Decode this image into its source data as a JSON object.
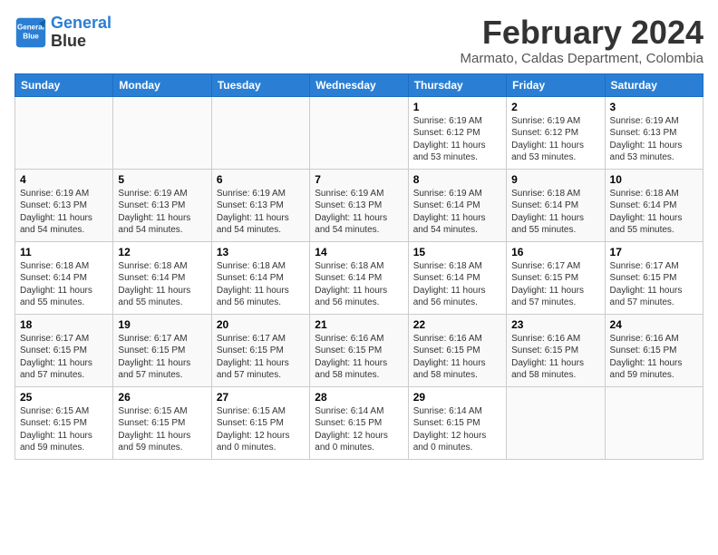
{
  "header": {
    "logo_line1": "General",
    "logo_line2": "Blue",
    "title": "February 2024",
    "subtitle": "Marmato, Caldas Department, Colombia"
  },
  "weekdays": [
    "Sunday",
    "Monday",
    "Tuesday",
    "Wednesday",
    "Thursday",
    "Friday",
    "Saturday"
  ],
  "weeks": [
    [
      {
        "day": "",
        "info": ""
      },
      {
        "day": "",
        "info": ""
      },
      {
        "day": "",
        "info": ""
      },
      {
        "day": "",
        "info": ""
      },
      {
        "day": "1",
        "info": "Sunrise: 6:19 AM\nSunset: 6:12 PM\nDaylight: 11 hours\nand 53 minutes."
      },
      {
        "day": "2",
        "info": "Sunrise: 6:19 AM\nSunset: 6:12 PM\nDaylight: 11 hours\nand 53 minutes."
      },
      {
        "day": "3",
        "info": "Sunrise: 6:19 AM\nSunset: 6:13 PM\nDaylight: 11 hours\nand 53 minutes."
      }
    ],
    [
      {
        "day": "4",
        "info": "Sunrise: 6:19 AM\nSunset: 6:13 PM\nDaylight: 11 hours\nand 54 minutes."
      },
      {
        "day": "5",
        "info": "Sunrise: 6:19 AM\nSunset: 6:13 PM\nDaylight: 11 hours\nand 54 minutes."
      },
      {
        "day": "6",
        "info": "Sunrise: 6:19 AM\nSunset: 6:13 PM\nDaylight: 11 hours\nand 54 minutes."
      },
      {
        "day": "7",
        "info": "Sunrise: 6:19 AM\nSunset: 6:13 PM\nDaylight: 11 hours\nand 54 minutes."
      },
      {
        "day": "8",
        "info": "Sunrise: 6:19 AM\nSunset: 6:14 PM\nDaylight: 11 hours\nand 54 minutes."
      },
      {
        "day": "9",
        "info": "Sunrise: 6:18 AM\nSunset: 6:14 PM\nDaylight: 11 hours\nand 55 minutes."
      },
      {
        "day": "10",
        "info": "Sunrise: 6:18 AM\nSunset: 6:14 PM\nDaylight: 11 hours\nand 55 minutes."
      }
    ],
    [
      {
        "day": "11",
        "info": "Sunrise: 6:18 AM\nSunset: 6:14 PM\nDaylight: 11 hours\nand 55 minutes."
      },
      {
        "day": "12",
        "info": "Sunrise: 6:18 AM\nSunset: 6:14 PM\nDaylight: 11 hours\nand 55 minutes."
      },
      {
        "day": "13",
        "info": "Sunrise: 6:18 AM\nSunset: 6:14 PM\nDaylight: 11 hours\nand 56 minutes."
      },
      {
        "day": "14",
        "info": "Sunrise: 6:18 AM\nSunset: 6:14 PM\nDaylight: 11 hours\nand 56 minutes."
      },
      {
        "day": "15",
        "info": "Sunrise: 6:18 AM\nSunset: 6:14 PM\nDaylight: 11 hours\nand 56 minutes."
      },
      {
        "day": "16",
        "info": "Sunrise: 6:17 AM\nSunset: 6:15 PM\nDaylight: 11 hours\nand 57 minutes."
      },
      {
        "day": "17",
        "info": "Sunrise: 6:17 AM\nSunset: 6:15 PM\nDaylight: 11 hours\nand 57 minutes."
      }
    ],
    [
      {
        "day": "18",
        "info": "Sunrise: 6:17 AM\nSunset: 6:15 PM\nDaylight: 11 hours\nand 57 minutes."
      },
      {
        "day": "19",
        "info": "Sunrise: 6:17 AM\nSunset: 6:15 PM\nDaylight: 11 hours\nand 57 minutes."
      },
      {
        "day": "20",
        "info": "Sunrise: 6:17 AM\nSunset: 6:15 PM\nDaylight: 11 hours\nand 57 minutes."
      },
      {
        "day": "21",
        "info": "Sunrise: 6:16 AM\nSunset: 6:15 PM\nDaylight: 11 hours\nand 58 minutes."
      },
      {
        "day": "22",
        "info": "Sunrise: 6:16 AM\nSunset: 6:15 PM\nDaylight: 11 hours\nand 58 minutes."
      },
      {
        "day": "23",
        "info": "Sunrise: 6:16 AM\nSunset: 6:15 PM\nDaylight: 11 hours\nand 58 minutes."
      },
      {
        "day": "24",
        "info": "Sunrise: 6:16 AM\nSunset: 6:15 PM\nDaylight: 11 hours\nand 59 minutes."
      }
    ],
    [
      {
        "day": "25",
        "info": "Sunrise: 6:15 AM\nSunset: 6:15 PM\nDaylight: 11 hours\nand 59 minutes."
      },
      {
        "day": "26",
        "info": "Sunrise: 6:15 AM\nSunset: 6:15 PM\nDaylight: 11 hours\nand 59 minutes."
      },
      {
        "day": "27",
        "info": "Sunrise: 6:15 AM\nSunset: 6:15 PM\nDaylight: 12 hours\nand 0 minutes."
      },
      {
        "day": "28",
        "info": "Sunrise: 6:14 AM\nSunset: 6:15 PM\nDaylight: 12 hours\nand 0 minutes."
      },
      {
        "day": "29",
        "info": "Sunrise: 6:14 AM\nSunset: 6:15 PM\nDaylight: 12 hours\nand 0 minutes."
      },
      {
        "day": "",
        "info": ""
      },
      {
        "day": "",
        "info": ""
      }
    ]
  ]
}
